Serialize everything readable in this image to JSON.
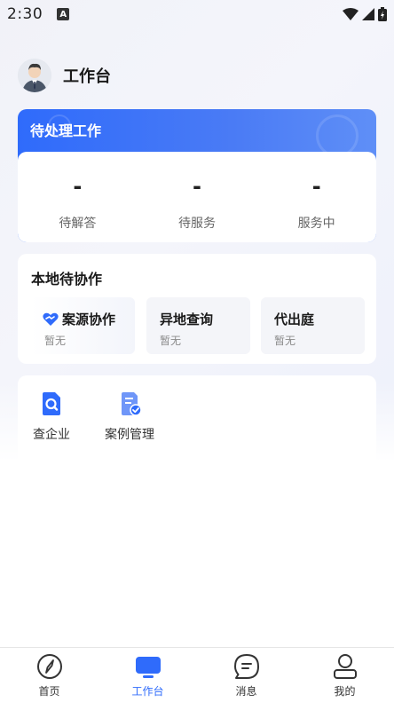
{
  "status_bar": {
    "time": "2:30",
    "notification_badge": "A"
  },
  "header": {
    "title": "工作台",
    "avatar_icon": "user-avatar"
  },
  "pending": {
    "title": "待处理工作",
    "stats": [
      {
        "value": "-",
        "label": "待解答"
      },
      {
        "value": "-",
        "label": "待服务"
      },
      {
        "value": "-",
        "label": "服务中"
      }
    ]
  },
  "local_collab": {
    "title": "本地待协作",
    "items": [
      {
        "name": "案源协作",
        "status": "暂无",
        "icon": "heart-handshake-icon"
      },
      {
        "name": "异地查询",
        "status": "暂无"
      },
      {
        "name": "代出庭",
        "status": "暂无"
      }
    ]
  },
  "tools": [
    {
      "label": "查企业",
      "icon": "search-document-icon"
    },
    {
      "label": "案例管理",
      "icon": "case-check-icon"
    }
  ],
  "bottom_nav": [
    {
      "label": "首页",
      "icon": "compass-icon",
      "active": false
    },
    {
      "label": "工作台",
      "icon": "monitor-icon",
      "active": true
    },
    {
      "label": "消息",
      "icon": "chat-icon",
      "active": false
    },
    {
      "label": "我的",
      "icon": "profile-icon",
      "active": false
    }
  ],
  "colors": {
    "accent": "#2f6bfb",
    "card_bg": "#ffffff",
    "page_bg": "#f2f3f8"
  }
}
